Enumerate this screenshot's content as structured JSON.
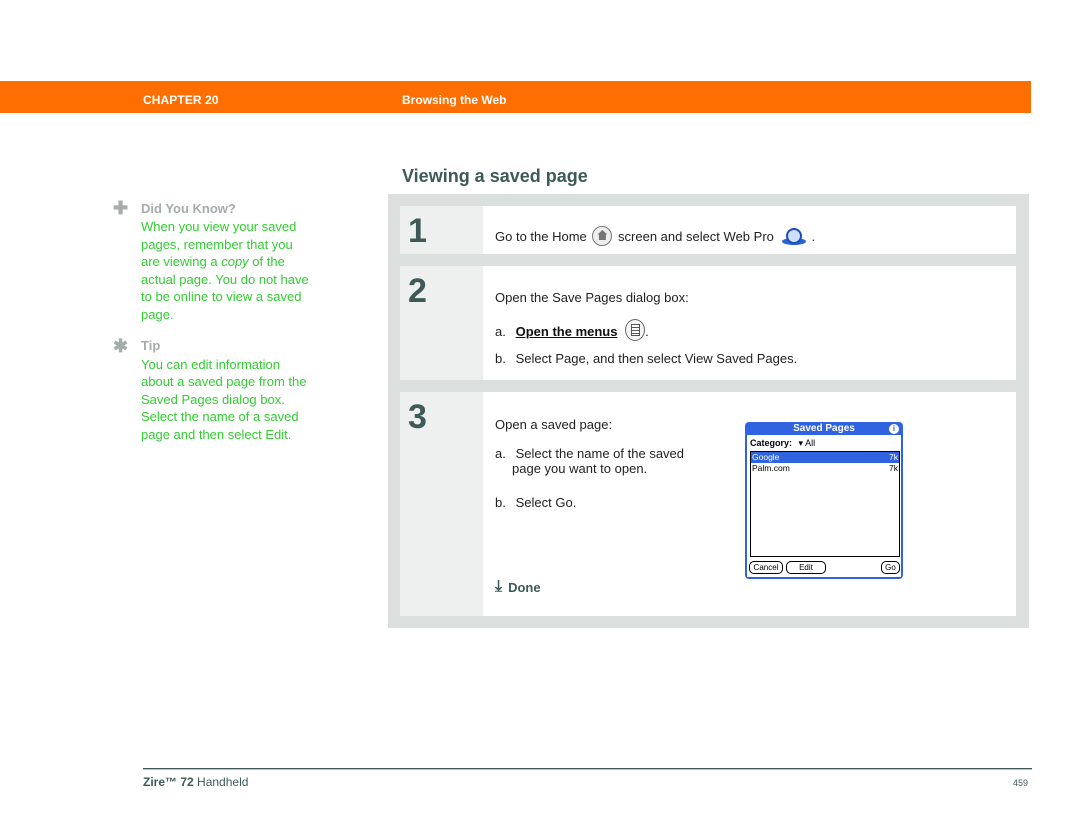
{
  "header": {
    "chapter": "CHAPTER 20",
    "title": "Browsing the Web",
    "accent_color": "#ff6e00"
  },
  "sidebar": {
    "did_you_know": {
      "icon": "plus-icon",
      "heading": "Did You Know?",
      "text_before": "When you view your saved pages, remember that you are viewing a ",
      "text_em": "copy",
      "text_after": " of the actual page. You do not have to be online to view a saved page."
    },
    "tip": {
      "icon": "asterisk-icon",
      "heading": "Tip",
      "text": "You can edit information about a saved page from the Saved Pages dialog box. Select the name of a saved page and then select Edit."
    }
  },
  "main": {
    "section_title": "Viewing a saved page",
    "steps": [
      {
        "number": "1",
        "text_before": "Go to the Home",
        "text_middle": "screen and select Web Pro",
        "text_after": "."
      },
      {
        "number": "2",
        "intro": "Open the Save Pages dialog box:",
        "a_label": "a.",
        "a_link": "Open the menus",
        "a_after": ".",
        "b_label": "b.",
        "b_text": "Select Page, and then select View Saved Pages."
      },
      {
        "number": "3",
        "intro": "Open a saved page:",
        "a_label": "a.",
        "a_text_1": "Select the name of the saved",
        "a_text_2": "page you want to open.",
        "b_label": "b.",
        "b_text": "Select Go.",
        "done": "Done"
      }
    ]
  },
  "palm_dialog": {
    "title": "Saved Pages",
    "category_label": "Category:",
    "category_value": "All",
    "items": [
      {
        "name": "Google",
        "size": "7k",
        "selected": true
      },
      {
        "name": "Palm.com",
        "size": "7k",
        "selected": false
      }
    ],
    "buttons": {
      "cancel": "Cancel",
      "edit": "Edit",
      "go": "Go"
    }
  },
  "footer": {
    "product_bold": "Zire™ 72",
    "product_rest": " Handheld",
    "page_number": "459"
  }
}
